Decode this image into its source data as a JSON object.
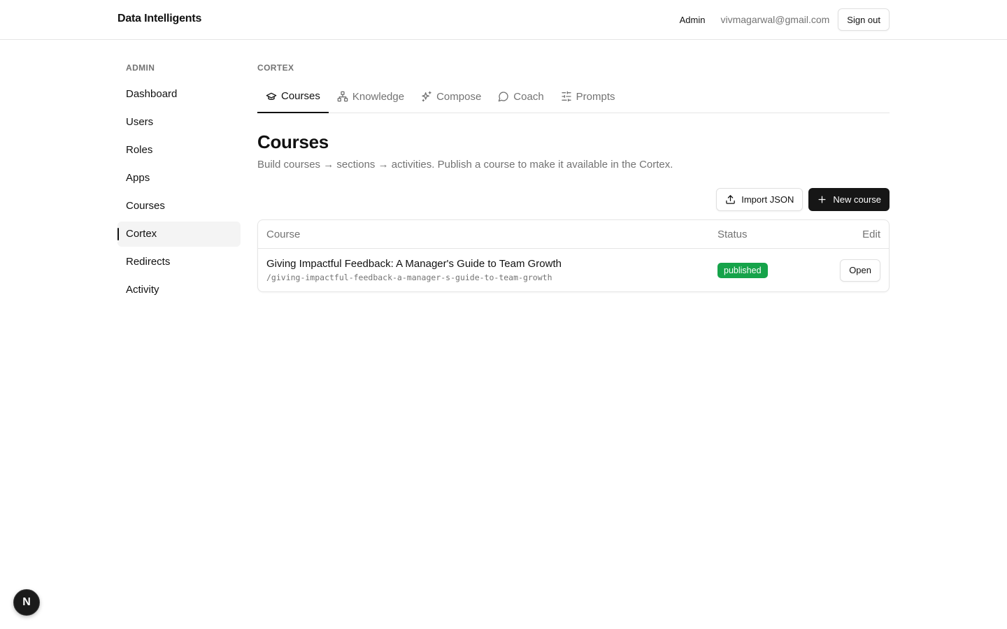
{
  "header": {
    "brand": "Data Intelligents",
    "role": "Admin",
    "email": "vivmagarwal@gmail.com",
    "sign_out_label": "Sign out"
  },
  "sidebar": {
    "heading": "ADMIN",
    "active": "Cortex",
    "items": [
      {
        "label": "Dashboard"
      },
      {
        "label": "Users"
      },
      {
        "label": "Roles"
      },
      {
        "label": "Apps"
      },
      {
        "label": "Courses"
      },
      {
        "label": "Cortex"
      },
      {
        "label": "Redirects"
      },
      {
        "label": "Activity"
      }
    ]
  },
  "main": {
    "section_label": "CORTEX",
    "tabs": [
      {
        "label": "Courses",
        "icon": "graduation-cap-icon",
        "active": true
      },
      {
        "label": "Knowledge",
        "icon": "network-icon",
        "active": false
      },
      {
        "label": "Compose",
        "icon": "sparkles-icon",
        "active": false
      },
      {
        "label": "Coach",
        "icon": "message-circle-icon",
        "active": false
      },
      {
        "label": "Prompts",
        "icon": "sliders-icon",
        "active": false
      }
    ],
    "title": "Courses",
    "description": "Build courses → sections → activities. Publish a course to make it available in the Cortex.",
    "import_label": "Import JSON",
    "new_label": "New course"
  },
  "table": {
    "columns": {
      "course": "Course",
      "status": "Status",
      "edit": "Edit"
    },
    "rows": [
      {
        "title": "Giving Impactful Feedback: A Manager's Guide to Team Growth",
        "slug": "/giving-impactful-feedback-a-manager-s-guide-to-team-growth",
        "status": "published",
        "action": "Open"
      }
    ]
  },
  "fab": {
    "label": "N"
  },
  "colors": {
    "published_badge": "#16a34a",
    "primary_button": "#161616",
    "muted_text": "#737373"
  }
}
